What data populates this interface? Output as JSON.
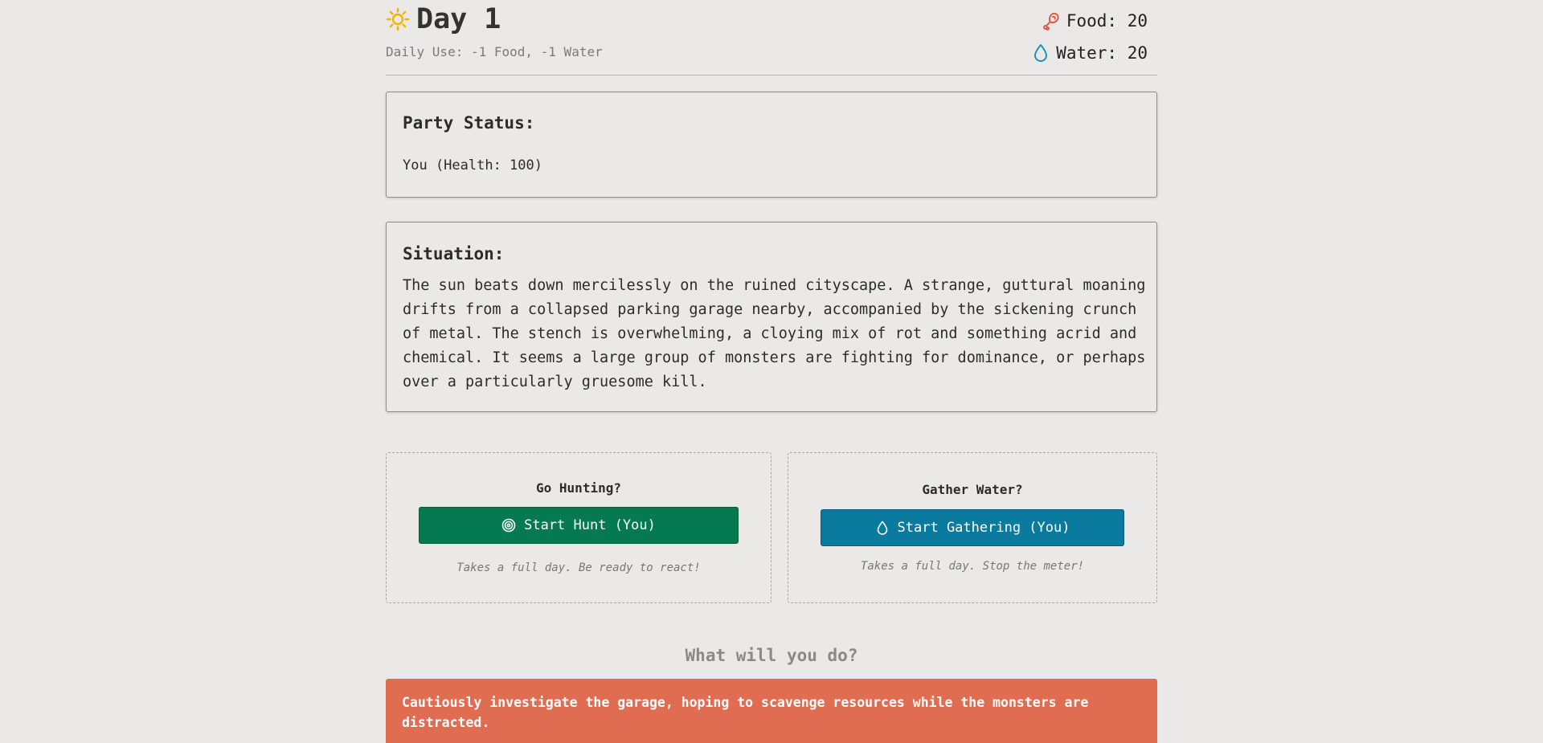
{
  "header": {
    "day_label": "Day 1",
    "daily_use": "Daily Use: -1 Food, -1 Water",
    "food_label": "Food: 20",
    "water_label": "Water: 20",
    "sun_color": "#f0b400",
    "food_icon_color": "#e05c4a",
    "water_icon_color": "#1a8fc0"
  },
  "party": {
    "title": "Party Status:",
    "member": "You (Health: 100)"
  },
  "situation": {
    "title": "Situation:",
    "text": "The sun beats down mercilessly on the ruined cityscape. A strange, guttural moaning drifts from a collapsed parking garage nearby, accompanied by the sickening crunch of metal. The stench is overwhelming, a cloying mix of rot and something acrid and chemical. It seems a large group of monsters are fighting for dominance, or perhaps over a particularly gruesome kill."
  },
  "actions": {
    "hunt": {
      "question": "Go Hunting?",
      "button": "Start Hunt (You)",
      "hint": "Takes a full day. Be ready to react!",
      "icon": "target-icon",
      "color": "#057a52"
    },
    "water": {
      "question": "Gather Water?",
      "button": "Start Gathering (You)",
      "hint": "Takes a full day. Stop the meter!",
      "icon": "droplet-icon",
      "color": "#0a7b9e"
    }
  },
  "prompt": "What will you do?",
  "choices": [
    {
      "text": "Cautiously investigate the garage, hoping to scavenge resources while the monsters are distracted.",
      "color": "#e06c52"
    }
  ]
}
